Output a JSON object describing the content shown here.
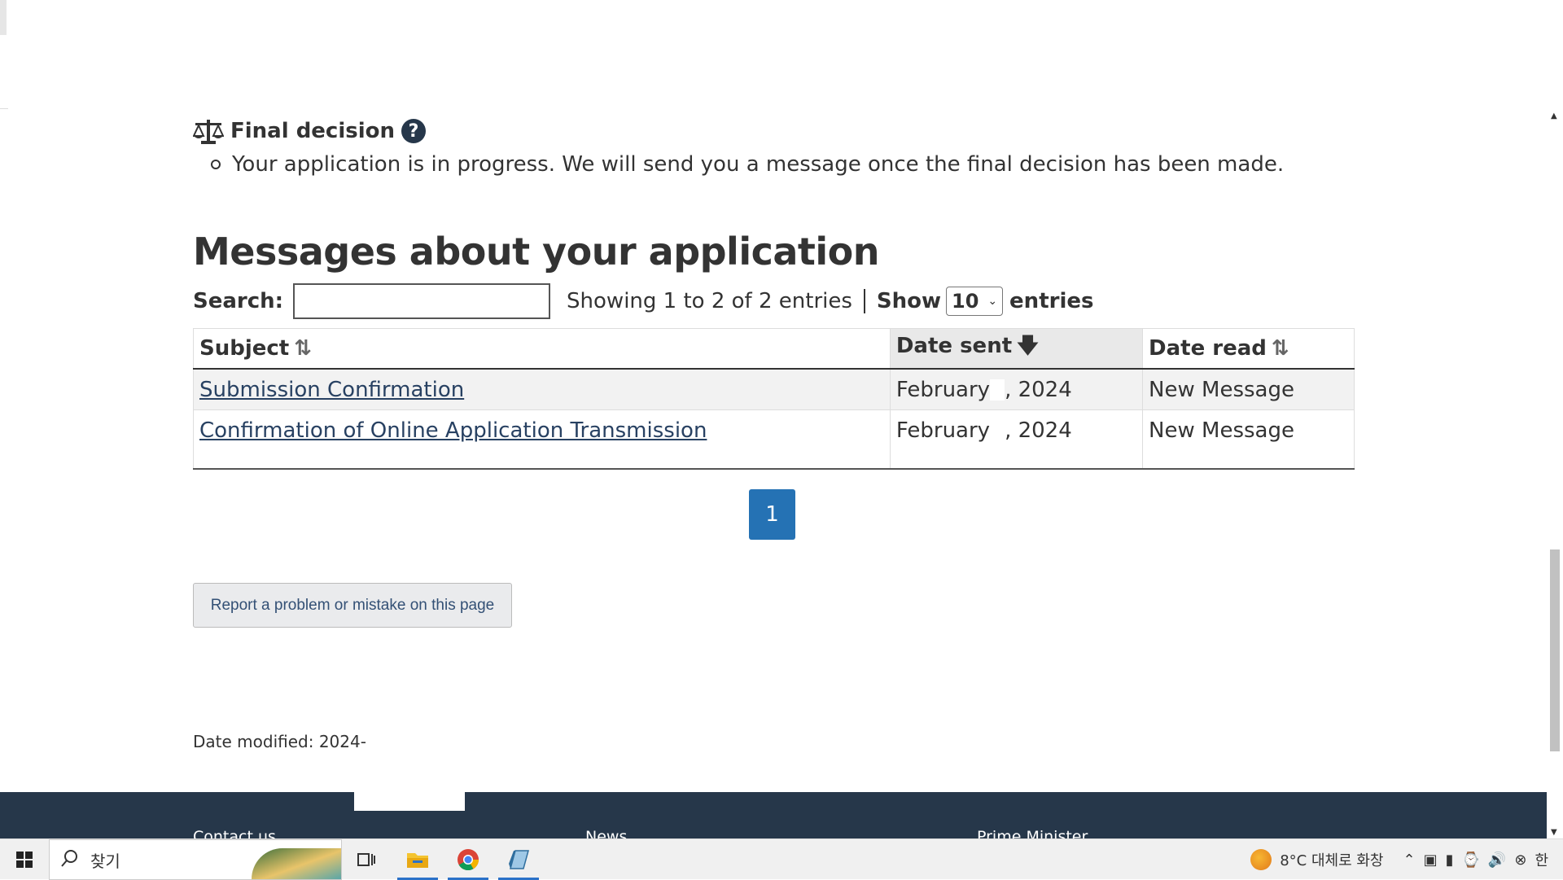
{
  "final_decision": {
    "title": "Final decision",
    "help_glyph": "?",
    "message": "Your application is in progress. We will send you a message once the final decision has been made."
  },
  "messages": {
    "heading": "Messages about your application",
    "search_label": "Search:",
    "search_value": "",
    "showing_text": "Showing 1 to 2 of 2 entries",
    "show_label": "Show",
    "entries_per_page": "10",
    "entries_label": "entries",
    "columns": {
      "subject": "Subject",
      "date_sent": "Date sent",
      "date_read": "Date read"
    },
    "rows": [
      {
        "subject": "Submission Confirmation",
        "date_month": "February",
        "date_year": ", 2024",
        "date_read": "New Message"
      },
      {
        "subject": "Confirmation of Online Application Transmission",
        "date_month": "February",
        "date_year": ", 2024",
        "date_read": "New Message"
      }
    ],
    "current_page": "1"
  },
  "report_button": "Report a problem or mistake on this page",
  "date_modified": "Date modified: 2024-",
  "footer": {
    "links": [
      "Contact us",
      "News",
      "Prime Minister"
    ]
  },
  "taskbar": {
    "search_placeholder": "찾기",
    "weather": "8°C  대체로 화창",
    "ime": "한"
  },
  "colors": {
    "page_button": "#2572b4",
    "footer_bg": "#26374a",
    "link": "#284162"
  }
}
